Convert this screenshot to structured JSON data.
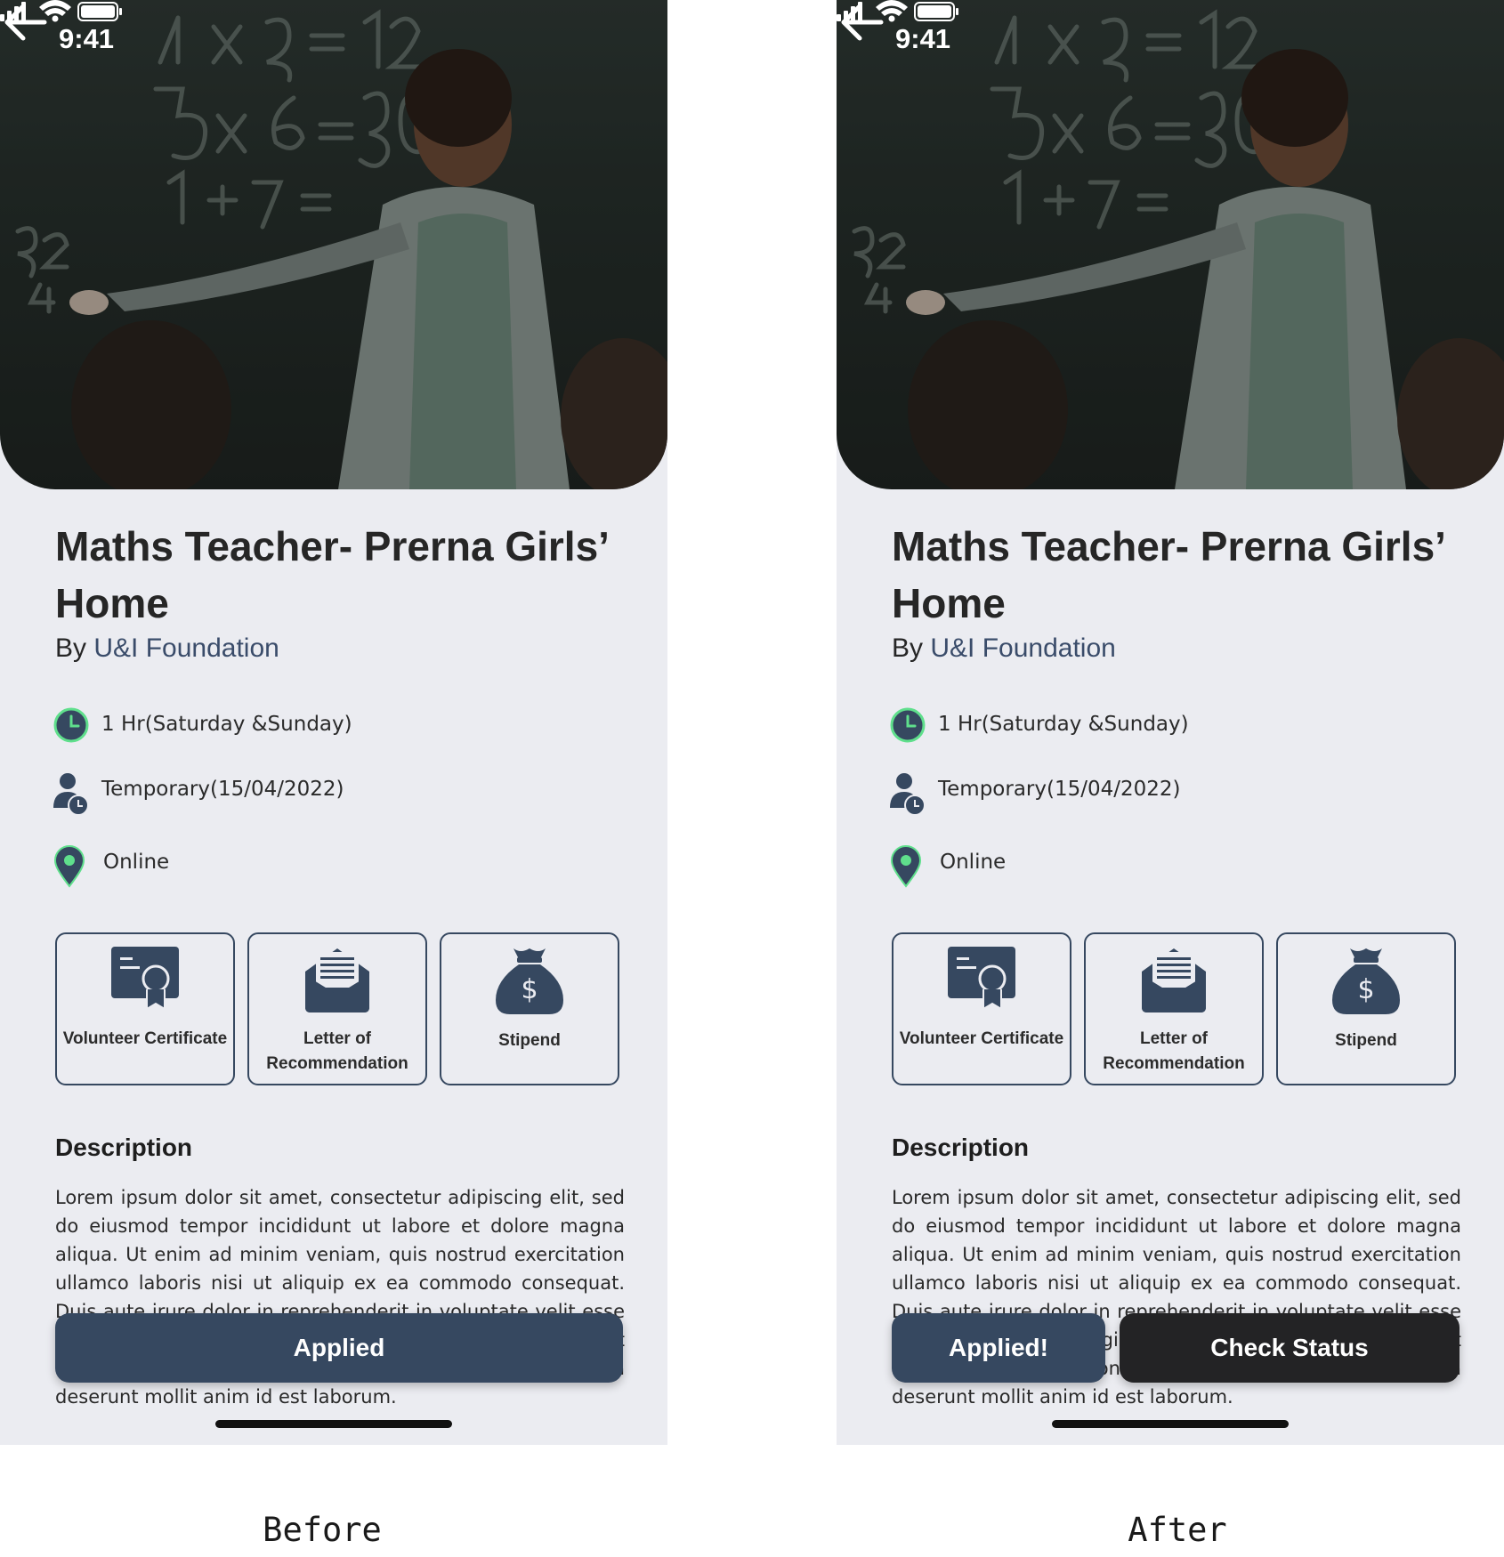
{
  "colors": {
    "accent": "#364860",
    "link": "#3a4c6a",
    "screen_bg": "#ebecf1",
    "check_status_bg": "#232325",
    "icon_green": "#5fdf8c"
  },
  "screens": [
    {
      "status_time": "9:41",
      "title": "Maths Teacher- Prerna Girls’ Home",
      "by_label": "By",
      "organization": "U&I Foundation",
      "info": [
        {
          "icon": "clock-icon",
          "text": "1 Hr(Saturday &Sunday)"
        },
        {
          "icon": "person-clock-icon",
          "text": "Temporary(15/04/2022)"
        },
        {
          "icon": "location-pin-icon",
          "text": "Online"
        }
      ],
      "perks": [
        {
          "icon": "certificate-icon",
          "label": "Volunteer Certificate"
        },
        {
          "icon": "letter-icon",
          "label": "Letter of Recommendation"
        },
        {
          "icon": "money-bag-icon",
          "label": "Stipend"
        }
      ],
      "description_heading": "Description",
      "description": "Lorem ipsum dolor sit amet, consectetur adipiscing elit, sed do eiusmod tempor incididunt ut labore et dolore magna aliqua. Ut enim ad minim veniam, quis nostrud exercitation ullamco laboris nisi ut aliquip ex ea commodo consequat. Duis aute irure dolor in reprehenderit in voluptate velit esse cillum dolore eu fugiat nulla pariatur. Excepteur sint occaecat cupidatat non proident, sunt in culpa qui officia deserunt mollit anim id est laborum.",
      "applied_button": "Applied",
      "caption": "Before"
    },
    {
      "status_time": "9:41",
      "title": "Maths Teacher- Prerna Girls’ Home",
      "by_label": "By",
      "organization": "U&I Foundation",
      "info": [
        {
          "icon": "clock-icon",
          "text": "1 Hr(Saturday &Sunday)"
        },
        {
          "icon": "person-clock-icon",
          "text": "Temporary(15/04/2022)"
        },
        {
          "icon": "location-pin-icon",
          "text": "Online"
        }
      ],
      "perks": [
        {
          "icon": "certificate-icon",
          "label": "Volunteer Certificate"
        },
        {
          "icon": "letter-icon",
          "label": "Letter of Recommendation"
        },
        {
          "icon": "money-bag-icon",
          "label": "Stipend"
        }
      ],
      "description_heading": "Description",
      "description": "Lorem ipsum dolor sit amet, consectetur adipiscing elit, sed do eiusmod tempor incididunt ut labore et dolore magna aliqua. Ut enim ad minim veniam, quis nostrud exercitation ullamco laboris nisi ut aliquip ex ea commodo consequat. Duis aute irure dolor in reprehenderit in voluptate velit esse cillum dolore eu fugiat nulla pariatur. Excepteur sint occaecat cupidatat non proident, sunt in culpa qui officia deserunt mollit anim id est laborum.",
      "applied_button": "Applied!",
      "check_status_button": "Check Status",
      "caption": "After"
    }
  ]
}
